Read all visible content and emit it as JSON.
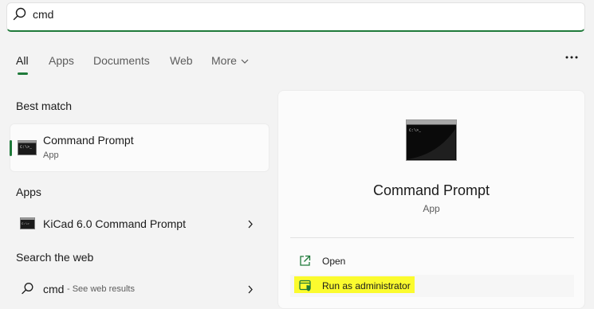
{
  "search": {
    "query": "cmd",
    "icon": "search-icon"
  },
  "tabs": [
    {
      "label": "All",
      "active": true
    },
    {
      "label": "Apps"
    },
    {
      "label": "Documents"
    },
    {
      "label": "Web"
    },
    {
      "label": "More"
    }
  ],
  "best_match": {
    "title": "Best match",
    "item": {
      "name": "Command Prompt",
      "type": "App",
      "icon": "command-prompt-icon"
    }
  },
  "apps": {
    "title": "Apps",
    "items": [
      {
        "label": "KiCad 6.0 Command Prompt",
        "icon": "kicad-command-prompt-icon"
      }
    ]
  },
  "web": {
    "title": "Search the web",
    "query": "cmd",
    "hint": "- See web results"
  },
  "detail": {
    "name": "Command Prompt",
    "type": "App",
    "actions": [
      {
        "label": "Open",
        "icon": "open-external-icon"
      },
      {
        "label": "Run as administrator",
        "icon": "shield-admin-icon",
        "highlighted": true
      }
    ]
  },
  "colors": {
    "accent": "#1f7a3a",
    "highlight": "#fbfb2e",
    "background": "#f3f3f3"
  }
}
